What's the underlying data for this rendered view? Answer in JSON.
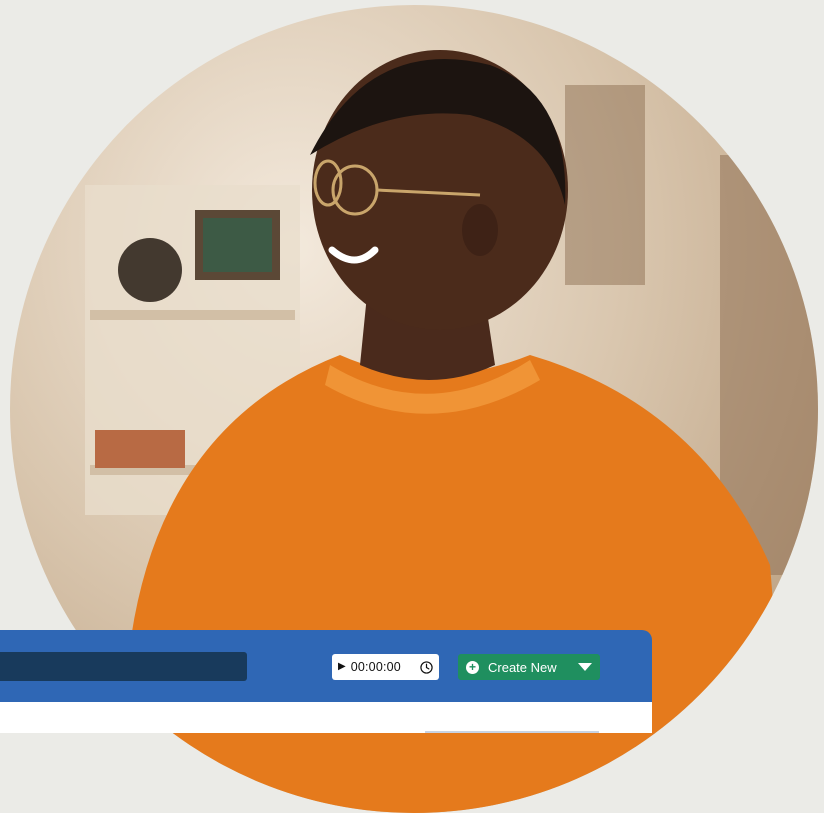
{
  "hero": {
    "subject": "smiling person in orange sweater"
  },
  "app_bar": {
    "search": {
      "value": "",
      "placeholder": ""
    },
    "timer": {
      "time": "00:00:00",
      "play_icon": "play-icon",
      "clock_icon": "clock-icon"
    },
    "create_new": {
      "label": "Create New",
      "icon": "plus-icon",
      "dropdown_icon": "caret-down-icon"
    }
  },
  "colors": {
    "app_bar": "#2f67b5",
    "search_field": "#183a5c",
    "create_button": "#1f8f5f",
    "background": "#ebebe7"
  }
}
